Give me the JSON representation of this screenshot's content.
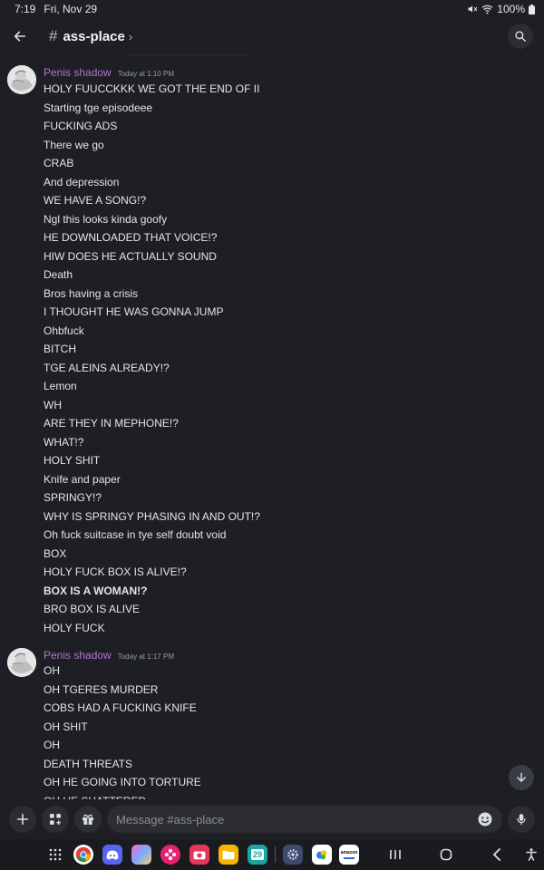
{
  "status": {
    "time": "7:19",
    "date": "Fri, Nov 29",
    "battery": "100%"
  },
  "header": {
    "channel_name": "ass-place",
    "hash_symbol": "#",
    "chevron": "›"
  },
  "groups": [
    {
      "username": "Penis shadow",
      "timestamp": "Today at 1:10 PM",
      "messages": [
        "HOLY FUUCCKKK WE GOT THE END OF II",
        "Starting tge episodeee",
        "FUCKING ADS",
        "There we go",
        "CRAB",
        "And depression",
        "WE HAVE A SONG!?",
        "Ngl this looks kinda goofy",
        "HE DOWNLOADED THAT VOICE!?",
        "HIW DOES HE ACTUALLY SOUND",
        "Death",
        "Bros having a crisis",
        "I THOUGHT HE WAS GONNA JUMP",
        "Ohbfuck",
        "BITCH",
        "TGE ALEINS ALREADY!?",
        "Lemon",
        "WH",
        "ARE THEY IN MEPHONE!?",
        "WHAT!?",
        "HOLY SHIT",
        "Knife and paper",
        "SPRINGY!?",
        "WHY IS SPRINGY PHASING IN AND OUT!?",
        "Oh fuck suitcase in tye self doubt void",
        "BOX",
        "HOLY FUCK BOX IS ALIVE!?",
        "BOX IS A WOMAN!?",
        "BRO BOX IS ALIVE",
        "HOLY FUCK"
      ]
    },
    {
      "username": "Penis shadow",
      "timestamp": "Today at 1:17 PM",
      "messages": [
        "OH",
        "OH TGERES MURDER",
        "COBS HAD A FUCKING KNIFE",
        "OH SHIT",
        "OH",
        "DEATH THREATS",
        "OH HE GOING INTO TORTURE",
        "OH HE SHATTERED"
      ]
    }
  ],
  "composer": {
    "placeholder": "Message #ass-place"
  },
  "nav": {
    "calendar_day": "29",
    "amazon_label": "amazon"
  },
  "colors": {
    "background": "#1e1f24",
    "username": "#b473cf",
    "accent_blurple": "#5865f2"
  }
}
